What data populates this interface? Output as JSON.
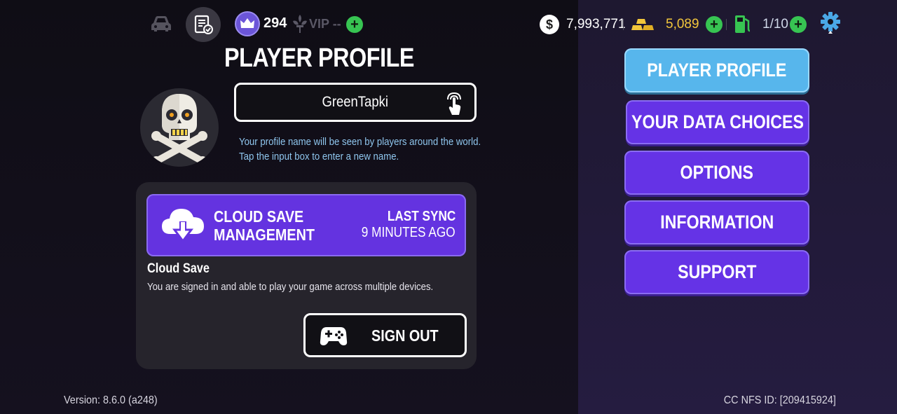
{
  "topbar": {
    "rank_value": "294",
    "vip_label": "VIP --",
    "cash_value": "7,993,771",
    "gold_value": "5,089",
    "fuel_value": "1/10",
    "icons": [
      "car-icon",
      "profile-checklist-icon",
      "crown-icon",
      "fleur-de-lis-icon",
      "dollar-icon",
      "gold-bars-icon",
      "fuel-pump-icon",
      "gear-icon"
    ]
  },
  "profile": {
    "title": "PLAYER PROFILE",
    "player_name": "GreenTapki",
    "hint_line1": "Your profile name will be seen by players around the world.",
    "hint_line2": "Tap the input box to enter a new name."
  },
  "cloud": {
    "title_line1": "CLOUD SAVE",
    "title_line2": "MANAGEMENT",
    "last_sync_label": "LAST SYNC",
    "last_sync_time": "9 MINUTES AGO",
    "heading": "Cloud Save",
    "description": "You are signed in and able to play your game across multiple devices.",
    "sign_out_label": "SIGN OUT"
  },
  "menu": {
    "items": [
      {
        "label": "PLAYER PROFILE",
        "active": true
      },
      {
        "label": "YOUR DATA CHOICES",
        "active": false
      },
      {
        "label": "OPTIONS",
        "active": false
      },
      {
        "label": "INFORMATION",
        "active": false
      },
      {
        "label": "SUPPORT",
        "active": false
      }
    ]
  },
  "footer": {
    "version": "Version: 8.6.0 (a248)",
    "nfs_id": "CC NFS ID: [209415924]"
  },
  "colors": {
    "accent_purple": "#6533e6",
    "active_blue": "#57b6ec",
    "gold": "#f2c63b",
    "plus_green": "#37c452",
    "hint_blue": "#8fc6ee"
  }
}
